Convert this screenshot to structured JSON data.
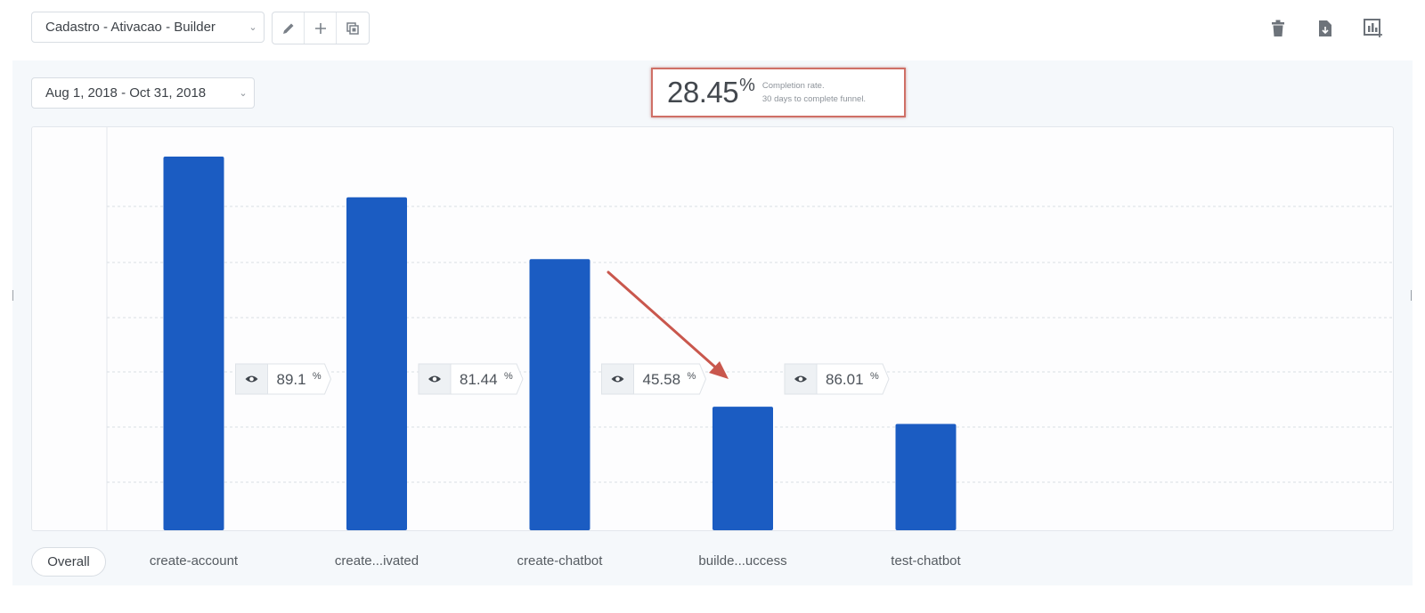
{
  "header": {
    "funnel_select": "Cadastro - Ativacao - Builder",
    "tools": [
      {
        "icon": "pencil-icon"
      },
      {
        "icon": "plus-icon"
      },
      {
        "icon": "duplicate-icon"
      }
    ],
    "right_actions": [
      {
        "icon": "trash-icon"
      },
      {
        "icon": "export-file-icon"
      },
      {
        "icon": "add-to-dashboard-icon"
      }
    ]
  },
  "date_range": "Aug 1, 2018 - Oct 31, 2018",
  "completion": {
    "value": "28.45",
    "unit": "%",
    "label": "Completion rate.",
    "window": "30 days to complete funnel."
  },
  "chart_data": {
    "type": "bar",
    "categories": [
      "create-account",
      "create...ivated",
      "create-chatbot",
      "builde...uccess",
      "test-chatbot"
    ],
    "values": [
      100,
      89.1,
      72.57,
      33.08,
      28.45
    ],
    "ylim": [
      0,
      100
    ],
    "grid": true,
    "bar_color": "#1b5cc2",
    "conversion_rates": [
      {
        "value": "89.1",
        "unit": "%"
      },
      {
        "value": "81.44",
        "unit": "%"
      },
      {
        "value": "45.58",
        "unit": "%"
      },
      {
        "value": "86.01",
        "unit": "%"
      }
    ]
  },
  "overall_button": "Overall",
  "colors": {
    "accent_bar": "#1b5cc2",
    "highlight_border": "#cf6f66",
    "annotation_arrow": "#c9574d"
  }
}
